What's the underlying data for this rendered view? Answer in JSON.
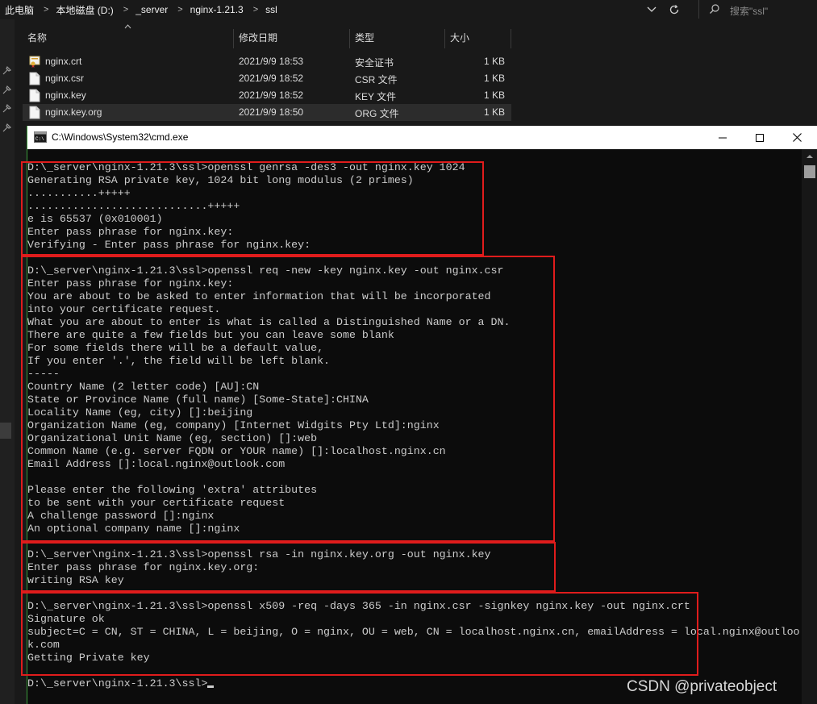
{
  "explorer": {
    "breadcrumb": [
      "此电脑",
      "本地磁盘 (D:)",
      "_server",
      "nginx-1.21.3",
      "ssl"
    ],
    "search_placeholder": "搜索\"ssl\"",
    "columns": [
      "名称",
      "修改日期",
      "类型",
      "大小"
    ],
    "files": [
      {
        "name": "nginx.crt",
        "date": "2021/9/9 18:53",
        "type": "安全证书",
        "size": "1 KB",
        "icon": "certificate-icon"
      },
      {
        "name": "nginx.csr",
        "date": "2021/9/9 18:52",
        "type": "CSR 文件",
        "size": "1 KB",
        "icon": "file-icon"
      },
      {
        "name": "nginx.key",
        "date": "2021/9/9 18:52",
        "type": "KEY 文件",
        "size": "1 KB",
        "icon": "file-icon"
      },
      {
        "name": "nginx.key.org",
        "date": "2021/9/9 18:50",
        "type": "ORG 文件",
        "size": "1 KB",
        "icon": "file-icon",
        "selected": true
      }
    ]
  },
  "cmd": {
    "title": "C:\\Windows\\System32\\cmd.exe",
    "lines": [
      "D:\\_server\\nginx-1.21.3\\ssl>openssl genrsa -des3 -out nginx.key 1024",
      "Generating RSA private key, 1024 bit long modulus (2 primes)",
      "...........+++++",
      "............................+++++",
      "e is 65537 (0x010001)",
      "Enter pass phrase for nginx.key:",
      "Verifying - Enter pass phrase for nginx.key:",
      "",
      "D:\\_server\\nginx-1.21.3\\ssl>openssl req -new -key nginx.key -out nginx.csr",
      "Enter pass phrase for nginx.key:",
      "You are about to be asked to enter information that will be incorporated",
      "into your certificate request.",
      "What you are about to enter is what is called a Distinguished Name or a DN.",
      "There are quite a few fields but you can leave some blank",
      "For some fields there will be a default value,",
      "If you enter '.', the field will be left blank.",
      "-----",
      "Country Name (2 letter code) [AU]:CN",
      "State or Province Name (full name) [Some-State]:CHINA",
      "Locality Name (eg, city) []:beijing",
      "Organization Name (eg, company) [Internet Widgits Pty Ltd]:nginx",
      "Organizational Unit Name (eg, section) []:web",
      "Common Name (e.g. server FQDN or YOUR name) []:localhost.nginx.cn",
      "Email Address []:local.nginx@outlook.com",
      "",
      "Please enter the following 'extra' attributes",
      "to be sent with your certificate request",
      "A challenge password []:nginx",
      "An optional company name []:nginx",
      "",
      "D:\\_server\\nginx-1.21.3\\ssl>openssl rsa -in nginx.key.org -out nginx.key",
      "Enter pass phrase for nginx.key.org:",
      "writing RSA key",
      "",
      "D:\\_server\\nginx-1.21.3\\ssl>openssl x509 -req -days 365 -in nginx.csr -signkey nginx.key -out nginx.crt",
      "Signature ok",
      "subject=C = CN, ST = CHINA, L = beijing, O = nginx, OU = web, CN = localhost.nginx.cn, emailAddress = local.nginx@outloo",
      "k.com",
      "Getting Private key",
      "",
      "D:\\_server\\nginx-1.21.3\\ssl>"
    ]
  },
  "watermark": "CSDN @privateobject",
  "highlight_color": "#e01c1c"
}
